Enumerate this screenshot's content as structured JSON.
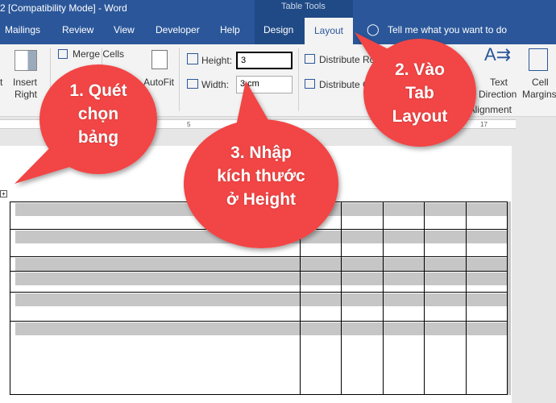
{
  "titlebar": {
    "title": "2 [Compatibility Mode]  -  Word",
    "context_group": "Table Tools"
  },
  "tabs": [
    "Mailings",
    "Review",
    "View",
    "Developer",
    "Help",
    "Design",
    "Layout"
  ],
  "tell_me": "Tell me what you want to do",
  "ribbon": {
    "insert_left_partial": "t",
    "insert_right": [
      "Insert",
      "Right"
    ],
    "merge_cells": "Merge Cells",
    "autofit": "AutoFit",
    "height_label": "Height:",
    "height_value": "3",
    "width_label": "Width:",
    "width_value": "3 cm",
    "distribute_rows": "Distribute Rows",
    "distribute_cols": "Distribute Columns",
    "text_direction": [
      "Text",
      "Direction"
    ],
    "cell_margins": [
      "Cell",
      "Margins"
    ],
    "alignment_group": "Alignment"
  },
  "ruler": {
    "marks": [
      "5",
      "1",
      "2",
      "17"
    ]
  },
  "table": {
    "rows": 6,
    "cols": 6
  },
  "callouts": {
    "step1": [
      "1. Quét",
      "chọn",
      "bảng"
    ],
    "step2": [
      "2. Vào",
      "Tab",
      "Layout"
    ],
    "step3": [
      "3. Nhập",
      "kích thước",
      "ở Height"
    ],
    "color": "#f24444"
  }
}
